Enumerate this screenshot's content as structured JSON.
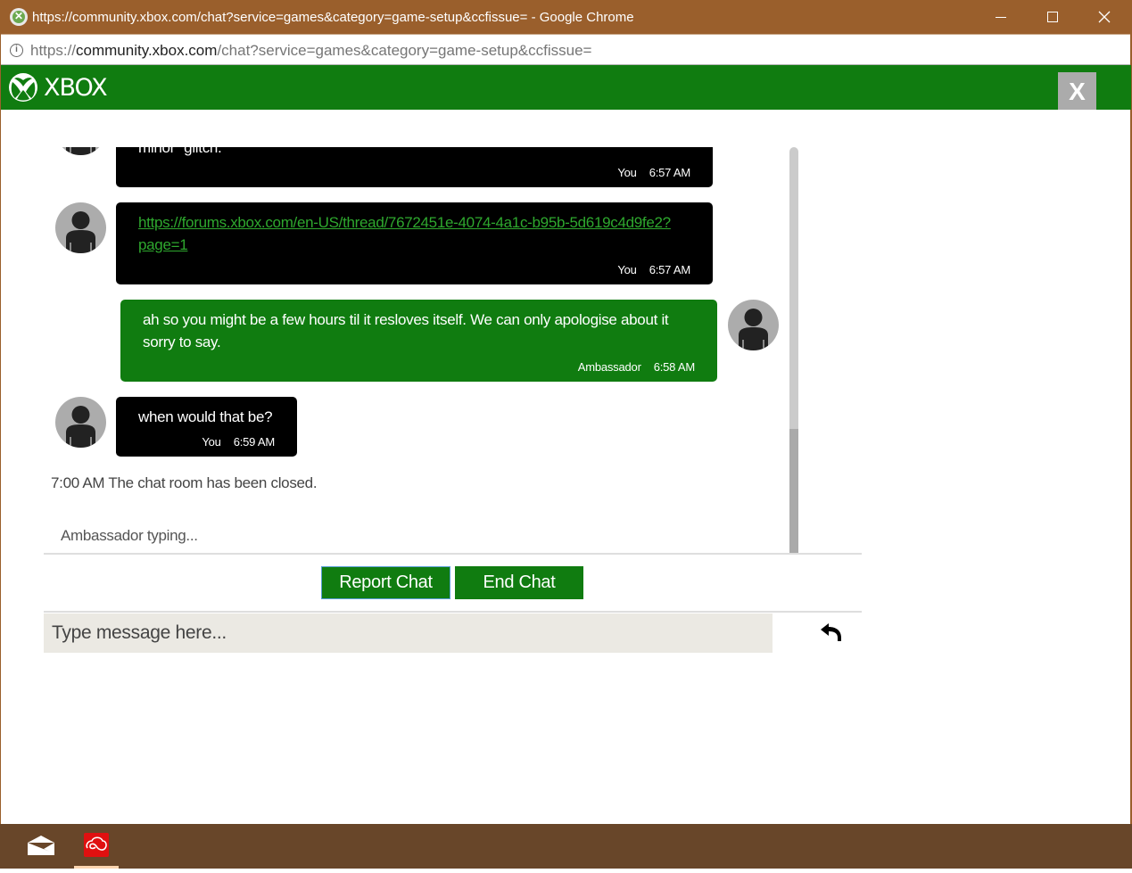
{
  "window": {
    "title": "https://community.xbox.com/chat?service=games&category=game-setup&ccfissue= - Google Chrome",
    "controls": {
      "minimize": "minimize",
      "maximize": "maximize",
      "close": "close"
    }
  },
  "address_bar": {
    "scheme": "https://",
    "host": "community.xbox.com",
    "path": "/chat?service=games&category=game-setup&ccfissue="
  },
  "header": {
    "brand": "XBOX",
    "close_label": "X",
    "colors": {
      "brand_green": "#107c10",
      "close_bg": "#ababab"
    }
  },
  "chat": {
    "messages": [
      {
        "sender": "You",
        "time": "6:57 AM",
        "text": "minor \"glitch.\"",
        "partial": true,
        "style": "you"
      },
      {
        "sender": "You",
        "time": "6:57 AM",
        "link": "https://forums.xbox.com/en-US/thread/7672451e-4074-4a1c-b95b-5d619c4d9fe2?page=1",
        "style": "you"
      },
      {
        "sender": "Ambassador",
        "time": "6:58 AM",
        "text": "ah so you might be a few hours til it resloves itself. We can only apologise about it sorry to say.",
        "style": "ambassador"
      },
      {
        "sender": "You",
        "time": "6:59 AM",
        "text": "when would that be?",
        "style": "you"
      }
    ],
    "system_message": "7:00 AM The chat room has been closed.",
    "typing_indicator": "Ambassador typing...",
    "scroll_position": 1.0
  },
  "actions": {
    "report_label": "Report Chat",
    "end_label": "End Chat"
  },
  "composer": {
    "placeholder": "Type message here...",
    "value": "",
    "send_icon": "reply-arrow-icon"
  },
  "taskbar": {
    "items": [
      {
        "name": "mail",
        "icon": "mail-icon",
        "active": false
      },
      {
        "name": "creative-cloud",
        "icon": "creative-cloud-icon",
        "active": true
      }
    ]
  }
}
